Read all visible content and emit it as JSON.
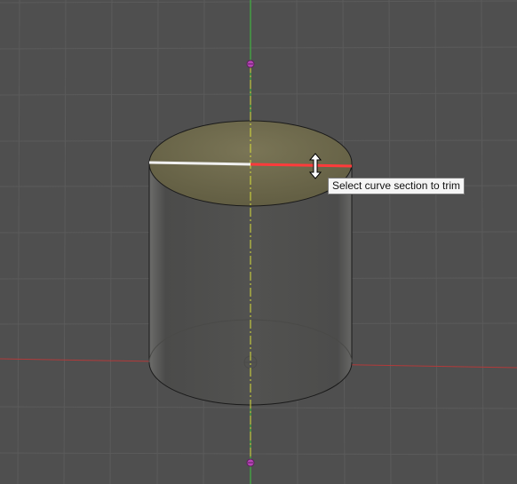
{
  "tooltip": {
    "text": "Select curve section to trim"
  },
  "colors": {
    "background": "#4f4f4f",
    "grid": "#5c5c5c",
    "x_axis": "#b23a3a",
    "z_axis": "#3cc43c",
    "construction_axis": "#d8df3a",
    "selected_section": "#ff3b3b",
    "remaining_section": "#ffffff",
    "top_face": "#6e6a4c",
    "side_face": "#545452"
  },
  "icons": {
    "cursor": "resize-vertical-cursor-icon",
    "axis_point": "axis-point-marker-icon",
    "origin": "origin-marker-icon"
  }
}
